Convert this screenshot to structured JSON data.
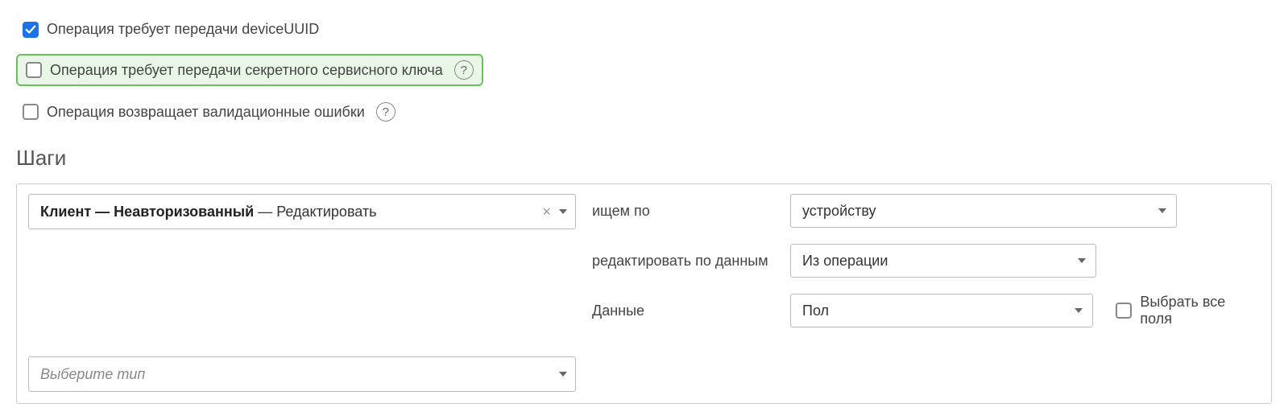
{
  "checkboxes": {
    "device_uuid": {
      "label": "Операция требует передачи deviceUUID",
      "checked": true
    },
    "secret_key": {
      "label": "Операция требует передачи секретного сервисного ключа",
      "checked": false,
      "help": "?"
    },
    "validation_errors": {
      "label": "Операция возвращает валидационные ошибки",
      "checked": false,
      "help": "?"
    }
  },
  "section_title": "Шаги",
  "step": {
    "selected": {
      "part1": "Клиент — Неавторизованный",
      "separator": " — ",
      "part2": "Редактировать"
    },
    "fields": {
      "search_by": {
        "label": "ищем по",
        "value": "устройству"
      },
      "edit_by": {
        "label": "редактировать по данным",
        "value": "Из операции"
      },
      "data": {
        "label": "Данные",
        "value": "Пол"
      }
    },
    "select_all": {
      "label": "Выбрать все поля",
      "checked": false
    }
  },
  "type_select": {
    "placeholder": "Выберите тип"
  }
}
